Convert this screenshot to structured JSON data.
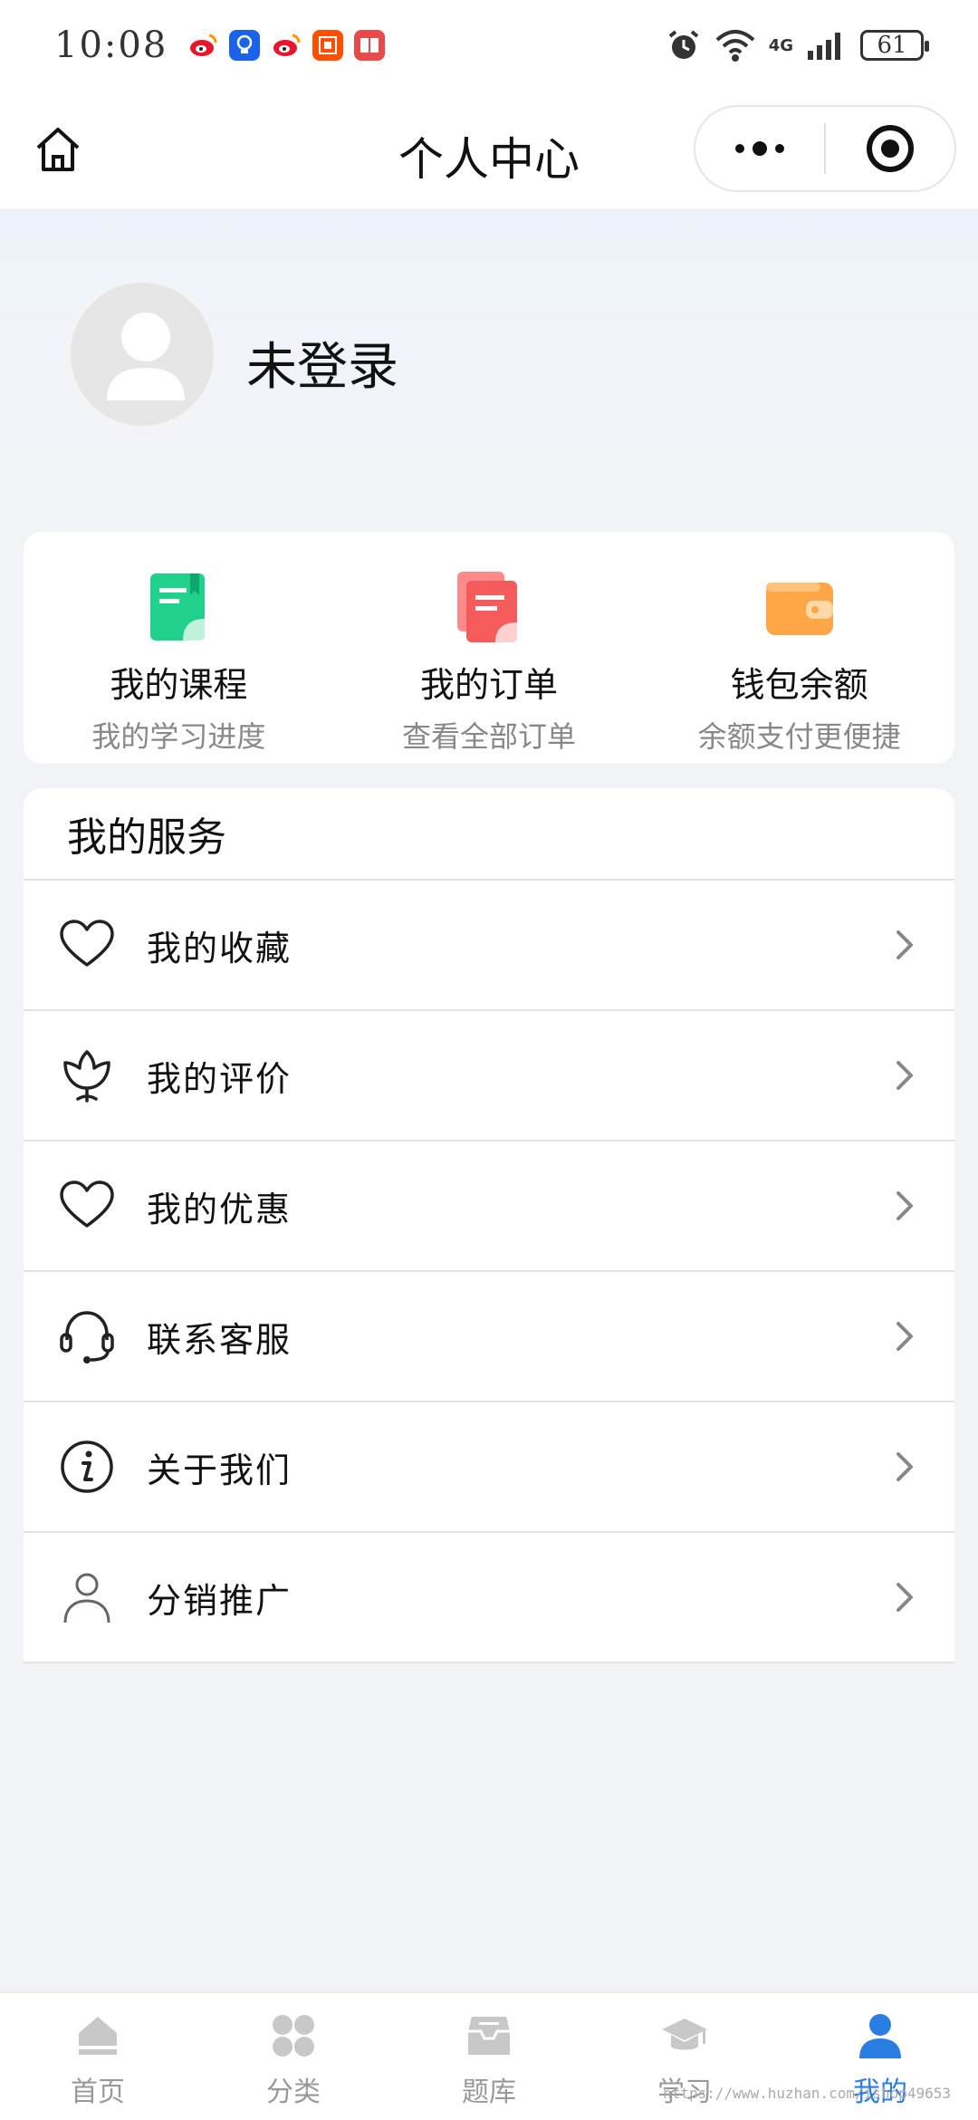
{
  "status": {
    "time": "10:08",
    "battery": "61",
    "network": "4G"
  },
  "nav": {
    "title": "个人中心"
  },
  "profile": {
    "login_text": "未登录"
  },
  "quick": [
    {
      "label": "我的课程",
      "sub": "我的学习进度",
      "icon": "book-icon",
      "color": "#1fd18b"
    },
    {
      "label": "我的订单",
      "sub": "查看全部订单",
      "icon": "document-icon",
      "color": "#f55b5b"
    },
    {
      "label": "钱包余额",
      "sub": "余额支付更便捷",
      "icon": "wallet-icon",
      "color": "#ffa646"
    }
  ],
  "services": {
    "title": "我的服务",
    "items": [
      {
        "label": "我的收藏",
        "icon": "heart-icon"
      },
      {
        "label": "我的评价",
        "icon": "tulip-icon"
      },
      {
        "label": "我的优惠",
        "icon": "heart-icon"
      },
      {
        "label": "联系客服",
        "icon": "headset-icon"
      },
      {
        "label": "关于我们",
        "icon": "info-icon"
      },
      {
        "label": "分销推广",
        "icon": "user-icon"
      }
    ]
  },
  "tabs": [
    {
      "label": "首页",
      "icon": "home-icon"
    },
    {
      "label": "分类",
      "icon": "grid-icon"
    },
    {
      "label": "题库",
      "icon": "inbox-icon"
    },
    {
      "label": "学习",
      "icon": "graduation-cap-icon"
    },
    {
      "label": "我的",
      "icon": "user-icon",
      "active": true
    }
  ],
  "watermark": "https://www.huzhan.com/ishop49653",
  "colors": {
    "accent": "#2a7de1",
    "page_bg": "#f2f3f6"
  }
}
